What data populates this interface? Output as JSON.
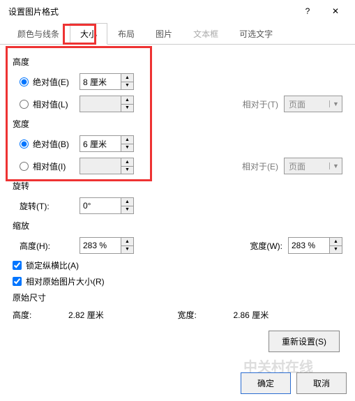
{
  "window": {
    "title": "设置图片格式",
    "help": "?",
    "close": "✕"
  },
  "tabs": [
    {
      "label": "颜色与线条"
    },
    {
      "label": "大小"
    },
    {
      "label": "布局"
    },
    {
      "label": "图片"
    },
    {
      "label": "文本框"
    },
    {
      "label": "可选文字"
    }
  ],
  "height": {
    "label": "高度",
    "abs_label": "绝对值(E)",
    "abs_value": "8 厘米",
    "rel_label": "相对值(L)",
    "rel_value": "",
    "rel_to_label": "相对于(T)",
    "rel_to_value": "页面"
  },
  "width": {
    "label": "宽度",
    "abs_label": "绝对值(B)",
    "abs_value": "6 厘米",
    "rel_label": "相对值(I)",
    "rel_value": "",
    "rel_to_label": "相对于(E)",
    "rel_to_value": "页面"
  },
  "rotate": {
    "label": "旋转",
    "field_label": "旋转(T):",
    "value": "0°"
  },
  "scale": {
    "label": "缩放",
    "h_label": "高度(H):",
    "h_value": "283 %",
    "w_label": "宽度(W):",
    "w_value": "283 %",
    "lock_label": "锁定纵横比(A)",
    "orig_label": "相对原始图片大小(R)"
  },
  "original": {
    "label": "原始尺寸",
    "h_label": "高度:",
    "h_value": "2.82 厘米",
    "w_label": "宽度:",
    "w_value": "2.86 厘米"
  },
  "reset": "重新设置(S)",
  "ok": "确定",
  "cancel": "取消",
  "watermark": "中关村在线"
}
